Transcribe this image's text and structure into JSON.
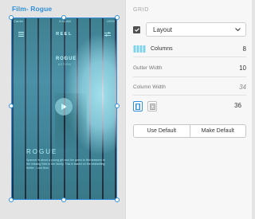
{
  "artboard": {
    "title": "Film- Rogue",
    "status": {
      "left": "Carrier",
      "time": "9:41 AM",
      "right": "100%"
    },
    "nav_title": "REEL",
    "hero_title": "ROGUE",
    "hero_subtitle": "ACTION",
    "movie_title": "ROGUE",
    "movie_description": "Spanner is about a young girl and her quest to find answers to the missing links in her family. This is based on the bestselling thriller - Lost Now."
  },
  "panel": {
    "section_label": "GRID",
    "layout_checked": true,
    "layout_value": "Layout",
    "columns_label": "Columns",
    "columns_value": "8",
    "gutter_label": "Gutter Width",
    "gutter_value": "10",
    "column_width_label": "Column Width",
    "column_width_value": "34",
    "margin_value": "36",
    "use_default_label": "Use Default",
    "make_default_label": "Make Default"
  },
  "colors": {
    "accent": "#2f8fdc",
    "grid_overlay": "#5ee2f0"
  },
  "icons": [
    "hamburger-menu-icon",
    "filter-sliders-icon",
    "play-icon",
    "check-icon",
    "chevron-down-icon",
    "grid-columns-icon",
    "linked-margins-icon",
    "unlinked-margins-icon"
  ]
}
